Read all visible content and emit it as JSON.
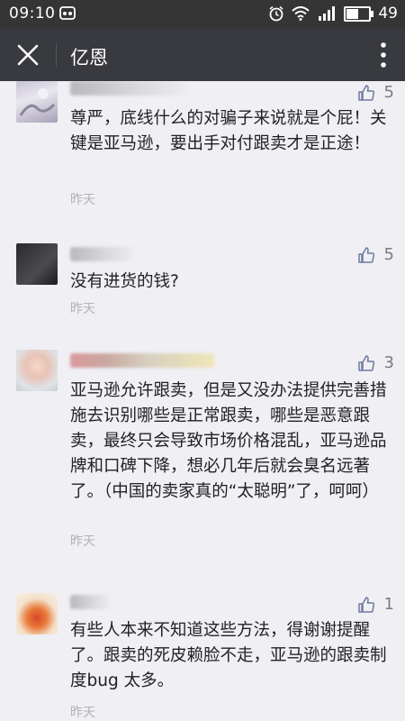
{
  "status_bar": {
    "time": "09:10",
    "battery": "49",
    "battery_level": 0.49
  },
  "app_bar": {
    "title": "亿恩"
  },
  "comments": [
    {
      "likes": "5",
      "text": "尊严，底线什么的对骗子来说就是个屁！关键是亚马逊，要出手对付跟卖才是正途！",
      "time": "昨天"
    },
    {
      "likes": "5",
      "text": "没有进货的钱?",
      "time": "昨天"
    },
    {
      "likes": "3",
      "text": "亚马逊允许跟卖，但是又没办法提供完善措施去识别哪些是正常跟卖，哪些是恶意跟卖，最终只会导致市场价格混乱，亚马逊品牌和口碑下降，想必几年后就会臭名远著了。（中国的卖家真的“太聪明”了，呵呵）",
      "time": "昨天"
    },
    {
      "likes": "1",
      "text": "有些人本来不知道这些方法，得谢谢提醒了。跟卖的死皮赖脸不走，亚马逊的跟卖制度bug 太多。",
      "time": "昨天"
    }
  ]
}
